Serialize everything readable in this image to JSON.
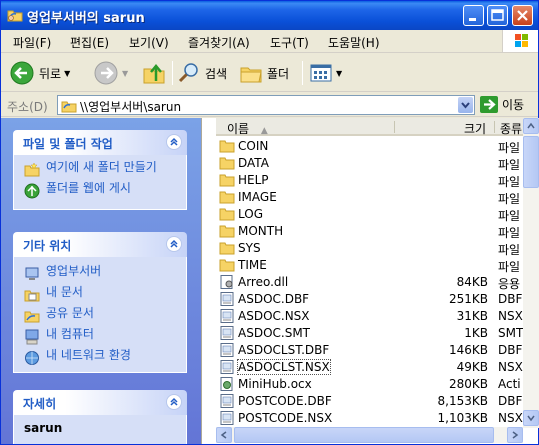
{
  "window": {
    "title": "영업부서버의 sarun"
  },
  "menu": [
    "파일(F)",
    "편집(E)",
    "보기(V)",
    "즐겨찾기(A)",
    "도구(T)",
    "도움말(H)"
  ],
  "toolbar": {
    "back": "뒤로",
    "search": "검색",
    "folders": "폴더"
  },
  "address": {
    "label": "주소(D)",
    "value": "\\\\영업부서버\\sarun",
    "go": "이동"
  },
  "file_tasks": {
    "title": "파일 및 폴더 작업",
    "items": [
      "여기에 새 폴더 만들기",
      "폴더를 웹에 게시"
    ]
  },
  "other_places": {
    "title": "기타 위치",
    "items": [
      "영업부서버",
      "내 문서",
      "공유 문서",
      "내 컴퓨터",
      "내 네트워크 환경"
    ]
  },
  "details": {
    "title": "자세히",
    "name": "sarun"
  },
  "columns": {
    "name": "이름",
    "size": "크기",
    "type": "종류"
  },
  "files": [
    {
      "name": "COIN",
      "size": "",
      "type": "파일",
      "icon": "folder"
    },
    {
      "name": "DATA",
      "size": "",
      "type": "파일",
      "icon": "folder"
    },
    {
      "name": "HELP",
      "size": "",
      "type": "파일",
      "icon": "folder"
    },
    {
      "name": "IMAGE",
      "size": "",
      "type": "파일",
      "icon": "folder"
    },
    {
      "name": "LOG",
      "size": "",
      "type": "파일",
      "icon": "folder"
    },
    {
      "name": "MONTH",
      "size": "",
      "type": "파일",
      "icon": "folder"
    },
    {
      "name": "SYS",
      "size": "",
      "type": "파일",
      "icon": "folder"
    },
    {
      "name": "TIME",
      "size": "",
      "type": "파일",
      "icon": "folder"
    },
    {
      "name": "Arreo.dll",
      "size": "84KB",
      "type": "응용",
      "icon": "dll"
    },
    {
      "name": "ASDOC.DBF",
      "size": "251KB",
      "type": "DBF",
      "icon": "doc"
    },
    {
      "name": "ASDOC.NSX",
      "size": "31KB",
      "type": "NSX",
      "icon": "doc"
    },
    {
      "name": "ASDOC.SMT",
      "size": "1KB",
      "type": "SMT",
      "icon": "doc"
    },
    {
      "name": "ASDOCLST.DBF",
      "size": "146KB",
      "type": "DBF",
      "icon": "doc"
    },
    {
      "name": "ASDOCLST.NSX",
      "size": "49KB",
      "type": "NSX",
      "icon": "doc"
    },
    {
      "name": "MiniHub.ocx",
      "size": "280KB",
      "type": "Acti",
      "icon": "ocx"
    },
    {
      "name": "POSTCODE.DBF",
      "size": "8,153KB",
      "type": "DBF",
      "icon": "doc"
    },
    {
      "name": "POSTCODE.NSX",
      "size": "1,103KB",
      "type": "NSX",
      "icon": "doc"
    }
  ],
  "colors": {
    "title_bar": "#0A50D8",
    "task_link": "#215DC6",
    "pane_gradient_top": "#7BA2E7"
  }
}
